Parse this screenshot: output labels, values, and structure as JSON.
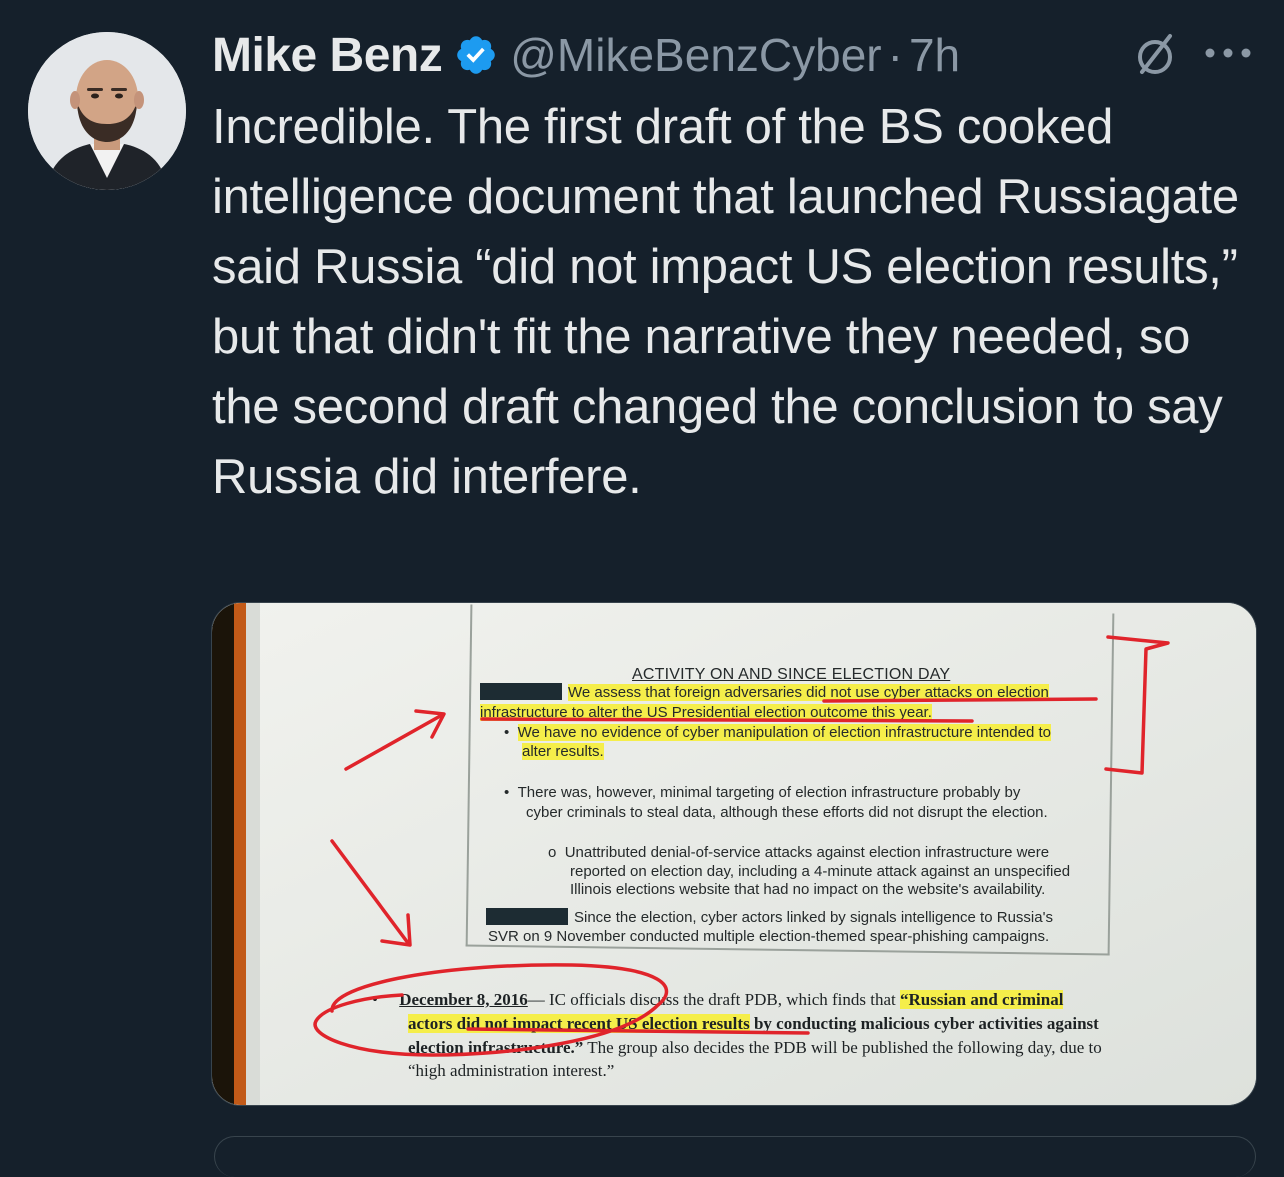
{
  "author": {
    "name": "Mike Benz",
    "handle": "@MikeBenzCyber",
    "separator": "·",
    "time": "7h",
    "verified_icon": "verified-badge-icon",
    "colors": {
      "verified": "#1d9bf0"
    }
  },
  "tweet": {
    "text": "Incredible. The first draft of the BS cooked intelligence document that launched Russiagate said Russia “did not impact US election results,” but that didn't fit the narrative they needed, so the second draft changed the conclusion to say Russia did interfere."
  },
  "media": {
    "document": {
      "title": "ACTIVITY ON AND SINCE ELECTION DAY",
      "line1": "We assess that foreign adversaries did not use cyber attacks on election",
      "line2": "infrastructure to alter the US Presidential election outcome this year.",
      "bullet1_line1": "We have no evidence of cyber manipulation of election infrastructure intended to",
      "bullet1_line2": "alter results.",
      "bullet2_line1": "There was, however, minimal targeting of election infrastructure probably by",
      "bullet2_line2": "cyber criminals to steal data, although these efforts did not disrupt the election.",
      "sub_line1": "Unattributed denial-of-service attacks against election infrastructure were",
      "sub_line2": "reported on election day, including a 4-minute attack against an unspecified",
      "sub_line3": "Illinois elections website that had no impact on the website's availability.",
      "svr_line1": "Since the election, cyber actors linked by signals intelligence to Russia's",
      "svr_line2": "SVR on 9 November conducted multiple election-themed spear-phishing campaigns."
    },
    "timeline": {
      "date": "December 8, 2016",
      "line1_rest": "— IC officials discuss the draft PDB, which finds that ",
      "line1_quote": "“Russian and criminal",
      "line2_quote": "actors did not impact recent US election results",
      "line2_rest": " by conducting malicious cyber activities against",
      "line3_quote": "election infrastructure.”",
      "line3_rest": " The group also decides the PDB will be published the following day, due to",
      "line4": "“high administration interest.”"
    },
    "colors": {
      "highlight": "#f5ee4a",
      "annotation_red": "#e0242b"
    }
  },
  "icons": {
    "grok": "grok-icon",
    "more": "more-icon"
  }
}
